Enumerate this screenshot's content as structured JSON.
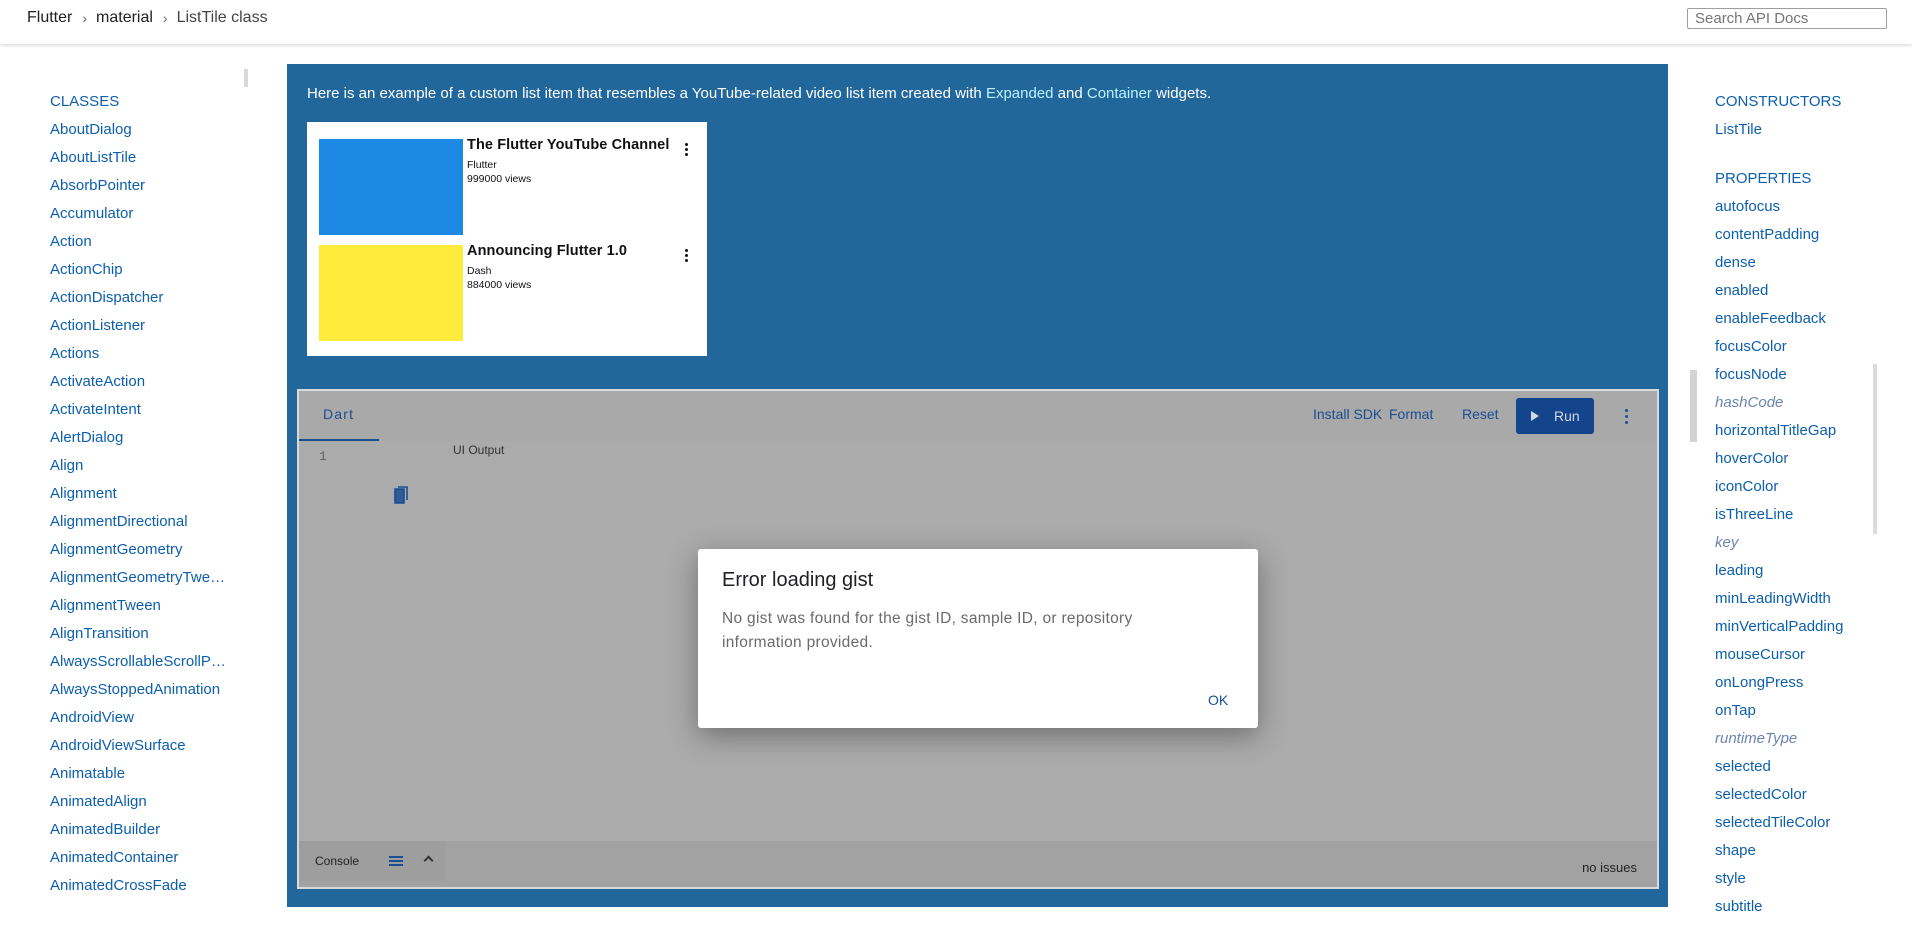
{
  "breadcrumb": [
    "Flutter",
    "material",
    "ListTile class"
  ],
  "search": {
    "placeholder": "Search API Docs"
  },
  "left_nav": {
    "heading": "CLASSES",
    "items": [
      "AboutDialog",
      "AboutListTile",
      "AbsorbPointer",
      "Accumulator",
      "Action",
      "ActionChip",
      "ActionDispatcher",
      "ActionListener",
      "Actions",
      "ActivateAction",
      "ActivateIntent",
      "AlertDialog",
      "Align",
      "Alignment",
      "AlignmentDirectional",
      "AlignmentGeometry",
      "AlignmentGeometryTwe…",
      "AlignmentTween",
      "AlignTransition",
      "AlwaysScrollableScrollP…",
      "AlwaysStoppedAnimation",
      "AndroidView",
      "AndroidViewSurface",
      "Animatable",
      "AnimatedAlign",
      "AnimatedBuilder",
      "AnimatedContainer",
      "AnimatedCrossFade"
    ]
  },
  "intro": {
    "before": "Here is an example of a custom list item that resembles a YouTube-related video list item created with ",
    "link1": "Expanded",
    "middle": " and ",
    "link2": "Container",
    "after": " widgets."
  },
  "videos": [
    {
      "title": "The Flutter YouTube Channel",
      "user": "Flutter",
      "views": "999000 views",
      "color": "#1e88e5"
    },
    {
      "title": "Announcing Flutter 1.0",
      "user": "Dash",
      "views": "884000 views",
      "color": "#ffeb3b"
    }
  ],
  "dartpad": {
    "tab": "Dart",
    "install_sdk": "Install SDK",
    "format": "Format",
    "reset": "Reset",
    "run": "Run",
    "line_number": "1",
    "ui_output": "UI Output",
    "console": "Console",
    "issues": "no issues"
  },
  "modal": {
    "title": "Error loading gist",
    "body": "No gist was found for the gist ID, sample ID, or repository information provided.",
    "ok": "OK"
  },
  "right_nav": {
    "constructors_heading": "CONSTRUCTORS",
    "constructors": [
      "ListTile"
    ],
    "properties_heading": "PROPERTIES",
    "properties": [
      {
        "name": "autofocus"
      },
      {
        "name": "contentPadding"
      },
      {
        "name": "dense"
      },
      {
        "name": "enabled"
      },
      {
        "name": "enableFeedback"
      },
      {
        "name": "focusColor"
      },
      {
        "name": "focusNode"
      },
      {
        "name": "hashCode",
        "inherited": true
      },
      {
        "name": "horizontalTitleGap"
      },
      {
        "name": "hoverColor"
      },
      {
        "name": "iconColor"
      },
      {
        "name": "isThreeLine"
      },
      {
        "name": "key",
        "inherited": true
      },
      {
        "name": "leading"
      },
      {
        "name": "minLeadingWidth"
      },
      {
        "name": "minVerticalPadding"
      },
      {
        "name": "mouseCursor"
      },
      {
        "name": "onLongPress"
      },
      {
        "name": "onTap"
      },
      {
        "name": "runtimeType",
        "inherited": true
      },
      {
        "name": "selected"
      },
      {
        "name": "selectedColor"
      },
      {
        "name": "selectedTileColor"
      },
      {
        "name": "shape"
      },
      {
        "name": "style"
      },
      {
        "name": "subtitle"
      }
    ]
  }
}
